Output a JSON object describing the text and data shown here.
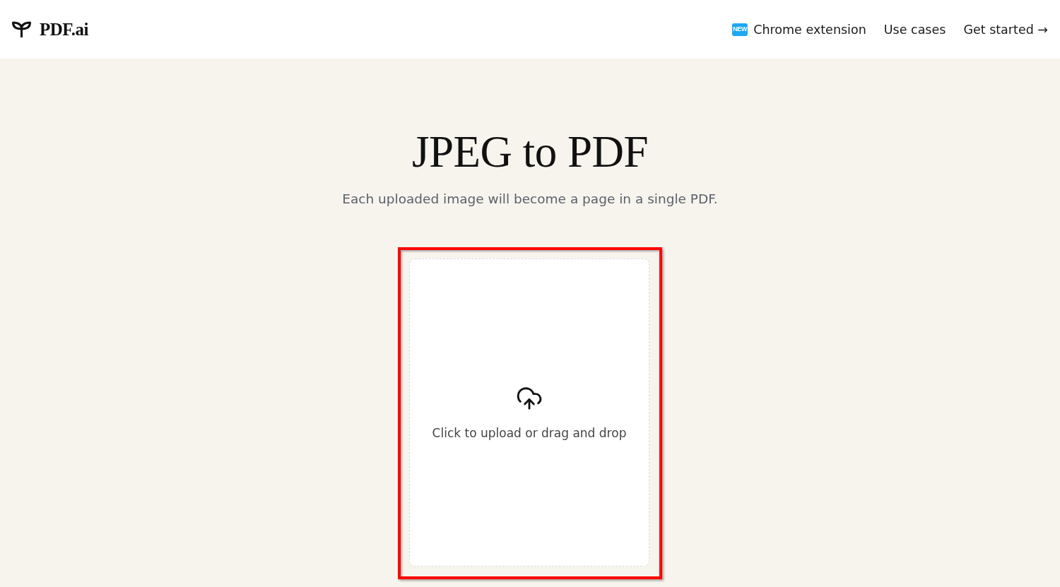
{
  "header": {
    "logo": "PDF.ai",
    "nav": [
      {
        "label": "Chrome extension",
        "badge": "NEW"
      },
      {
        "label": "Use cases"
      },
      {
        "label": "Get started →"
      }
    ]
  },
  "hero": {
    "title": "JPEG to PDF",
    "subtitle": "Each uploaded image will become a page in a single PDF."
  },
  "upload": {
    "prompt": "Click to upload or drag and drop",
    "highlighted": true
  }
}
